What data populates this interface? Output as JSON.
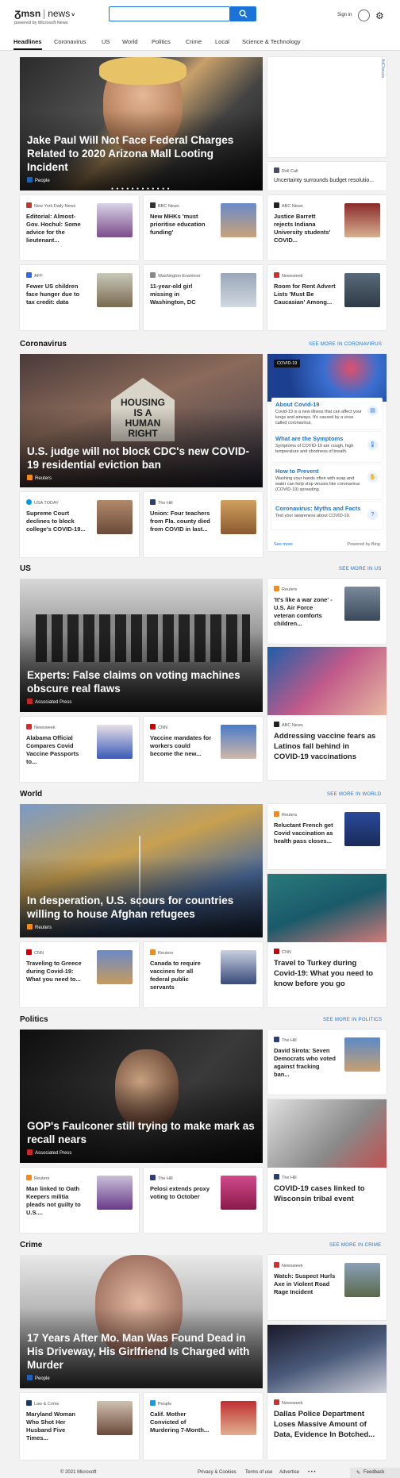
{
  "header": {
    "logo": "msn",
    "logo_section": "news",
    "powered": "powered by Microsoft News",
    "search_placeholder": "",
    "signin": "Sign in"
  },
  "nav": [
    "Headlines",
    "Coronavirus",
    "US",
    "World",
    "Politics",
    "Crime",
    "Local",
    "Science & Technology"
  ],
  "ad_label": "AdChoices",
  "top": {
    "hero": {
      "title": "Jake Paul Will Not Face Federal Charges Related to 2020 Arizona Mall Looting Incident",
      "source": "People"
    },
    "side": {
      "source": "Roll Call",
      "title": "Uncertainty surrounds budget resolutio..."
    },
    "row1": [
      {
        "source": "New York Daily News",
        "title": "Editorial: Almost-Gov. Hochul: Some advice for the lieutenant..."
      },
      {
        "source": "BBC News",
        "title": "New MHKs 'must prioritise education funding'"
      },
      {
        "source": "ABC News",
        "title": "Justice Barrett rejects Indiana University students' COVID..."
      }
    ],
    "row2": [
      {
        "source": "AFP",
        "title": "Fewer US children face hunger due to tax credit: data"
      },
      {
        "source": "Washington Examiner",
        "title": "11-year-old girl missing in Washington, DC"
      },
      {
        "source": "Newsweek",
        "title": "Room for Rent Advert Lists 'Must Be Caucasian' Among..."
      }
    ]
  },
  "coronavirus": {
    "heading": "Coronavirus",
    "more": "SEE MORE IN CORONAVIRUS",
    "hero": {
      "title": "U.S. judge will not block CDC's new COVID-19 residential eviction ban",
      "source": "Reuters",
      "sign": "HOUSING IS A HUMAN RIGHT"
    },
    "cards": [
      {
        "source": "USA TODAY",
        "title": "Supreme Court declines to block college's COVID-19..."
      },
      {
        "source": "The Hill",
        "title": "Union: Four teachers from Fla. county died from COVID in last..."
      }
    ],
    "panel": {
      "tag": "COVID-19",
      "items": [
        {
          "title": "About Covid-19",
          "desc": "Covid-19 is a new illness that can affect your lungs and airways. It's caused by a virus called coronavirus."
        },
        {
          "title": "What are the Symptoms",
          "desc": "Symptoms of COVID-19 are cough, high temperature and shortness of breath."
        },
        {
          "title": "How to Prevent",
          "desc": "Washing your hands often with soap and water can help stop viruses like coronavirus (COVID-19) spreading."
        },
        {
          "title": "Coronavirus: Myths and Facts",
          "desc": "Test your awareness about COVID-19."
        }
      ],
      "see_more": "See more",
      "powered": "Powered by Bing"
    }
  },
  "us": {
    "heading": "US",
    "more": "SEE MORE IN US",
    "hero": {
      "title": "Experts: False claims on voting machines obscure real flaws",
      "source": "Associated Press"
    },
    "side": {
      "source": "Reuters",
      "title": "'It's like a war zone' - U.S. Air Force veteran comforts children..."
    },
    "tall": {
      "source": "ABC News",
      "title": "Addressing vaccine fears as Latinos fall behind in COVID-19 vaccinations"
    },
    "cards": [
      {
        "source": "Newsweek",
        "title": "Alabama Official Compares Covid Vaccine Passports to..."
      },
      {
        "source": "CNN",
        "title": "Vaccine mandates for workers could become the new..."
      }
    ]
  },
  "world": {
    "heading": "World",
    "more": "SEE MORE IN WORLD",
    "hero": {
      "title": "In desperation, U.S. scours for countries willing to house Afghan refugees",
      "source": "Reuters"
    },
    "side": {
      "source": "Reuters",
      "title": "Reluctant French get Covid vaccination as health pass closes..."
    },
    "tall": {
      "source": "CNN",
      "title": "Travel to Turkey during Covid-19: What you need to know before you go"
    },
    "cards": [
      {
        "source": "CNN",
        "title": "Traveling to Greece during Covid-19: What you need to..."
      },
      {
        "source": "Reuters",
        "title": "Canada to require vaccines for all federal public servants"
      }
    ]
  },
  "politics": {
    "heading": "Politics",
    "more": "SEE MORE IN POLITICS",
    "hero": {
      "title": "GOP's Faulconer still trying to make mark as recall nears",
      "source": "Associated Press"
    },
    "side": {
      "source": "The Hill",
      "title": "David Sirota: Seven Democrats who voted against fracking ban..."
    },
    "tall": {
      "source": "The Hill",
      "title": "COVID-19 cases linked to Wisconsin tribal event"
    },
    "cards": [
      {
        "source": "Reuters",
        "title": "Man linked to Oath Keepers militia pleads not guilty to U.S...."
      },
      {
        "source": "The Hill",
        "title": "Pelosi extends proxy voting to October"
      }
    ]
  },
  "crime": {
    "heading": "Crime",
    "more": "SEE MORE IN CRIME",
    "hero": {
      "title": "17 Years After Mo. Man Was Found Dead in His Driveway, His Girlfriend Is Charged with Murder",
      "source": "People"
    },
    "side": {
      "source": "Newsweek",
      "title": "Watch: Suspect Hurls Axe in Violent Road Rage Incident"
    },
    "tall": {
      "source": "Newsweek",
      "title": "Dallas Police Department Loses Massive Amount of Data, Evidence In Botched..."
    },
    "cards": [
      {
        "source": "Law & Crime",
        "title": "Maryland Woman Who Shot Her Husband Five Times..."
      },
      {
        "source": "People",
        "title": "Calif. Mother Convicted of Murdering 7-Month..."
      }
    ]
  },
  "footer": {
    "copyright": "© 2021 Microsoft",
    "links": [
      "Privacy & Cookies",
      "Terms of use",
      "Advertise"
    ],
    "dots": "• • •",
    "feedback": "Feedback"
  }
}
